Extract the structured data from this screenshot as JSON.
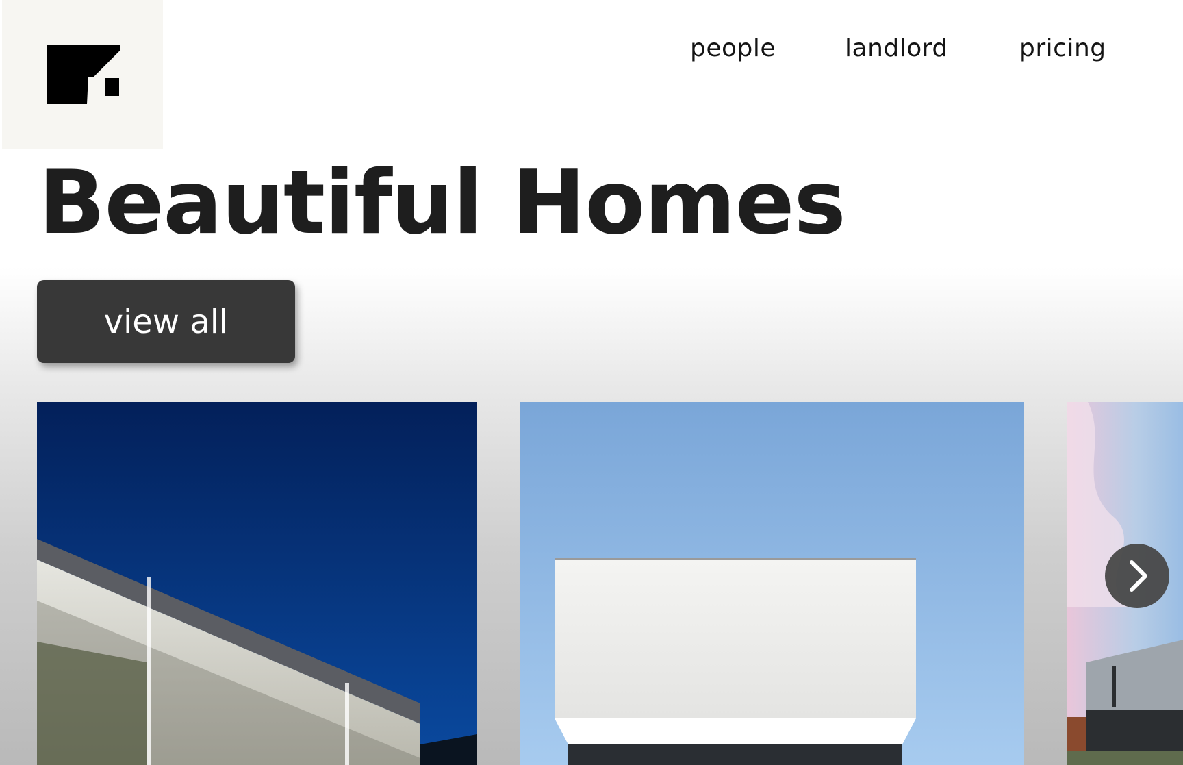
{
  "header": {
    "logo_icon": "brand-logo-icon",
    "nav": [
      {
        "label": "people"
      },
      {
        "label": "landlord"
      },
      {
        "label": "pricing"
      }
    ]
  },
  "hero": {
    "title": "Beautiful  Homes",
    "cta_label": "view all"
  },
  "gallery": {
    "items": [
      {
        "icon": "house-photo"
      },
      {
        "icon": "house-photo"
      },
      {
        "icon": "house-photo"
      }
    ],
    "next_icon": "chevron-right-icon"
  },
  "colors": {
    "button_bg": "#383838",
    "logo_bg": "#f7f6f2",
    "text": "#141414"
  }
}
